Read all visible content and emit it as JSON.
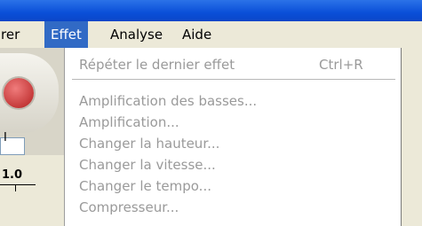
{
  "menubar": {
    "items": [
      {
        "label": "rer",
        "active": false
      },
      {
        "label": "Effet",
        "active": true
      },
      {
        "label": "Analyse",
        "active": false
      },
      {
        "label": "Aide",
        "active": false
      }
    ]
  },
  "toolbar": {
    "selection_glyph": "I",
    "ruler_value": "1.0"
  },
  "dropdown": {
    "repeat": {
      "label": "Répéter le dernier effet",
      "shortcut": "Ctrl+R"
    },
    "items": [
      "Amplification des basses...",
      "Amplification...",
      "Changer la hauteur...",
      "Changer la vitesse...",
      "Changer le tempo...",
      "Compresseur..."
    ]
  },
  "colors": {
    "titlebar": "#0a4fd8",
    "menu_highlight": "#316ac5",
    "disabled_text": "#9a9a9a"
  }
}
